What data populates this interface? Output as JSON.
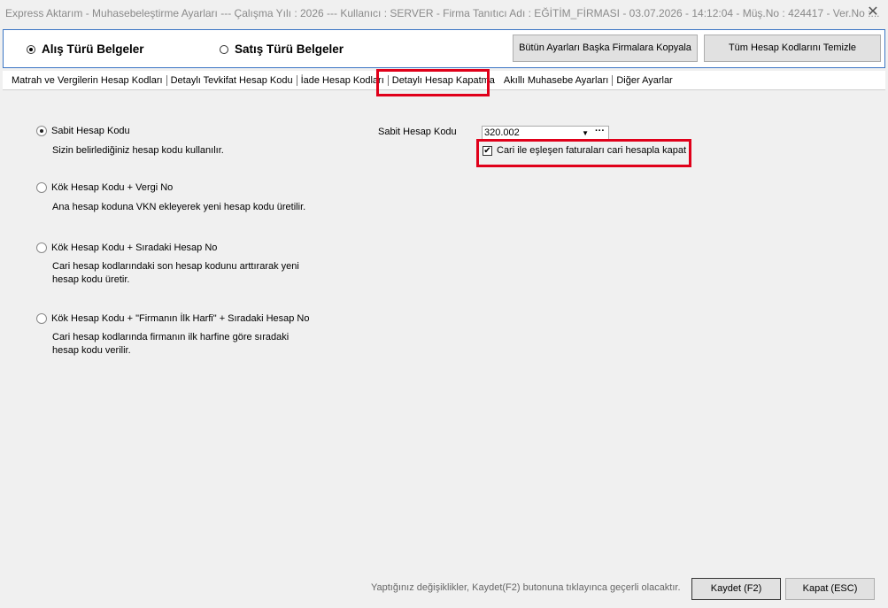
{
  "window": {
    "title": "Express Aktarım - Muhasebeleştirme Ayarları  ---  Çalışma Yılı : 2026  ---  Kullanıcı : SERVER - Firma Tanıtıcı Adı : EĞİTİM_FİRMASI - 03.07.2026 - 14:12:04 - Müş.No : 424417 - Ver.No :...",
    "close_glyph": "✕"
  },
  "doc_type": {
    "purchase_label": "Alış Türü Belgeler",
    "sales_label": "Satış Türü Belgeler",
    "selected": "purchase"
  },
  "header_buttons": {
    "copy_settings": "Bütün Ayarları Başka Firmalara Kopyala",
    "clear_codes": "Tüm Hesap Kodlarını Temizle"
  },
  "tabs": [
    {
      "label": "Matrah ve Vergilerin Hesap Kodları"
    },
    {
      "label": "Detaylı Tevkifat Hesap Kodu"
    },
    {
      "label": "İade Hesap Kodları"
    },
    {
      "label": "Detaylı Hesap Kapatma"
    },
    {
      "label": "Akıllı Muhasebe Ayarları"
    },
    {
      "label": "Diğer Ayarlar"
    }
  ],
  "active_tab": "Detaylı Hesap Kapatma",
  "options": [
    {
      "label": "Sabit Hesap Kodu",
      "desc": "Sizin belirlediğiniz hesap kodu kullanılır.",
      "checked": true
    },
    {
      "label": "Kök Hesap Kodu + Vergi No",
      "desc": "Ana hesap koduna VKN ekleyerek yeni hesap kodu üretilir.",
      "checked": false
    },
    {
      "label": "Kök Hesap Kodu + Sıradaki Hesap No",
      "desc": "Cari hesap kodlarındaki son hesap kodunu arttırarak yeni hesap kodu üretir.",
      "checked": false
    },
    {
      "label": "Kök Hesap Kodu + \"Firmanın İlk Harfi\" + Sıradaki Hesap No",
      "desc": "Cari hesap kodlarında firmanın ilk harfine göre sıradaki hesap kodu verilir.",
      "checked": false
    }
  ],
  "fixed_code": {
    "label": "Sabit Hesap Kodu",
    "value": "320.002",
    "dropdown_glyph": "▼",
    "more_glyph": "···"
  },
  "close_matching": {
    "label": "Cari ile eşleşen faturaları cari hesapla kapat",
    "checked": true,
    "check_glyph": "✔"
  },
  "footer": {
    "note": "Yaptığınız değişiklikler, Kaydet(F2) butonuna tıklayınca geçerli olacaktır.",
    "save": "Kaydet (F2)",
    "close": "Kapat (ESC)"
  },
  "colors": {
    "highlight": "#e0001a",
    "panel_border": "#3c76c4"
  }
}
